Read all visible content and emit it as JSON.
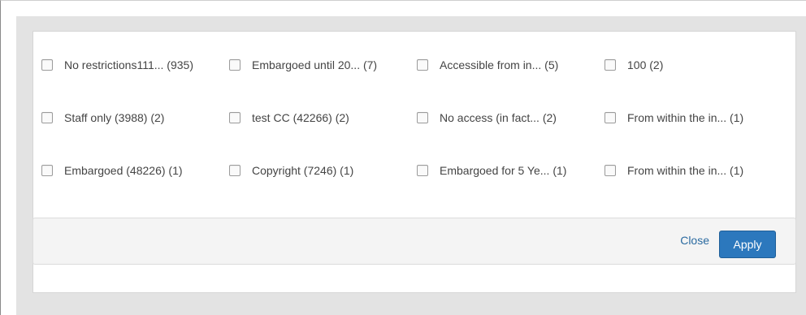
{
  "filters": {
    "rows": [
      [
        "No restrictions111... (935)",
        "Embargoed until 20... (7)",
        "Accessible from in... (5)",
        "100 (2)"
      ],
      [
        "Staff only (3988) (2)",
        "test CC (42266) (2)",
        "No access (in fact... (2)",
        "From within the in... (1)"
      ],
      [
        "Embargoed (48226) (1)",
        "Copyright (7246) (1)",
        "Embargoed for 5 Ye... (1)",
        "From within the in... (1)"
      ]
    ]
  },
  "footer": {
    "close_label": "Close",
    "apply_label": "Apply"
  },
  "colors": {
    "accent": "#2c78bd",
    "link": "#2a6aa0",
    "frame": "#e3e3e3"
  }
}
